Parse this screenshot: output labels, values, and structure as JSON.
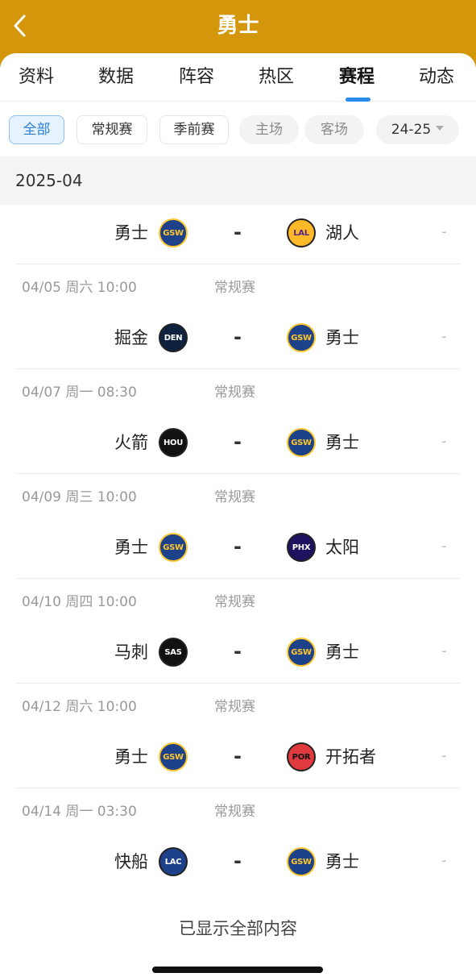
{
  "header": {
    "title": "勇士",
    "back_icon": "chevron-left-icon",
    "background": "#d4960a"
  },
  "tabs": [
    "资料",
    "数据",
    "阵容",
    "热区",
    "赛程",
    "动态"
  ],
  "active_tab": "赛程",
  "accent_color": "#2b8cf0",
  "filters": {
    "type": [
      "全部",
      "常规赛",
      "季前赛"
    ],
    "venue": [
      "主场",
      "客场"
    ],
    "season": "24-25",
    "active": "全部"
  },
  "month": "2025-04",
  "matches": [
    {
      "date": "",
      "type": "",
      "home": {
        "name": "勇士",
        "abbr": "GSW"
      },
      "away": {
        "name": "湖人",
        "abbr": "LAL"
      },
      "score": "-",
      "status": "-"
    },
    {
      "date": "04/05  周六 10:00",
      "type": "常规赛",
      "home": {
        "name": "掘金",
        "abbr": "DEN"
      },
      "away": {
        "name": "勇士",
        "abbr": "GSW"
      },
      "score": "-",
      "status": "-"
    },
    {
      "date": "04/07  周一 08:30",
      "type": "常规赛",
      "home": {
        "name": "火箭",
        "abbr": "HOU"
      },
      "away": {
        "name": "勇士",
        "abbr": "GSW"
      },
      "score": "-",
      "status": "-"
    },
    {
      "date": "04/09  周三 10:00",
      "type": "常规赛",
      "home": {
        "name": "勇士",
        "abbr": "GSW"
      },
      "away": {
        "name": "太阳",
        "abbr": "PHX"
      },
      "score": "-",
      "status": "-"
    },
    {
      "date": "04/10  周四 10:00",
      "type": "常规赛",
      "home": {
        "name": "马刺",
        "abbr": "SAS"
      },
      "away": {
        "name": "勇士",
        "abbr": "GSW"
      },
      "score": "-",
      "status": "-"
    },
    {
      "date": "04/12  周六 10:00",
      "type": "常规赛",
      "home": {
        "name": "勇士",
        "abbr": "GSW"
      },
      "away": {
        "name": "开拓者",
        "abbr": "POR"
      },
      "score": "-",
      "status": "-"
    },
    {
      "date": "04/14  周一 03:30",
      "type": "常规赛",
      "home": {
        "name": "快船",
        "abbr": "LAC"
      },
      "away": {
        "name": "勇士",
        "abbr": "GSW"
      },
      "score": "-",
      "status": "-"
    }
  ],
  "team_colors": {
    "GSW": {
      "bg": "#1d428a",
      "fg": "#ffc72c"
    },
    "LAL": {
      "bg": "#fdb927",
      "fg": "#552583"
    },
    "DEN": {
      "bg": "#0e2240",
      "fg": "#ffffff"
    },
    "HOU": {
      "bg": "#111111",
      "fg": "#ffffff"
    },
    "PHX": {
      "bg": "#1d1160",
      "fg": "#ffffff"
    },
    "SAS": {
      "bg": "#111111",
      "fg": "#ffffff"
    },
    "POR": {
      "bg": "#e03a3e",
      "fg": "#111111"
    },
    "LAC": {
      "bg": "#1d428a",
      "fg": "#ffffff"
    }
  },
  "footer_text": "已显示全部内容"
}
